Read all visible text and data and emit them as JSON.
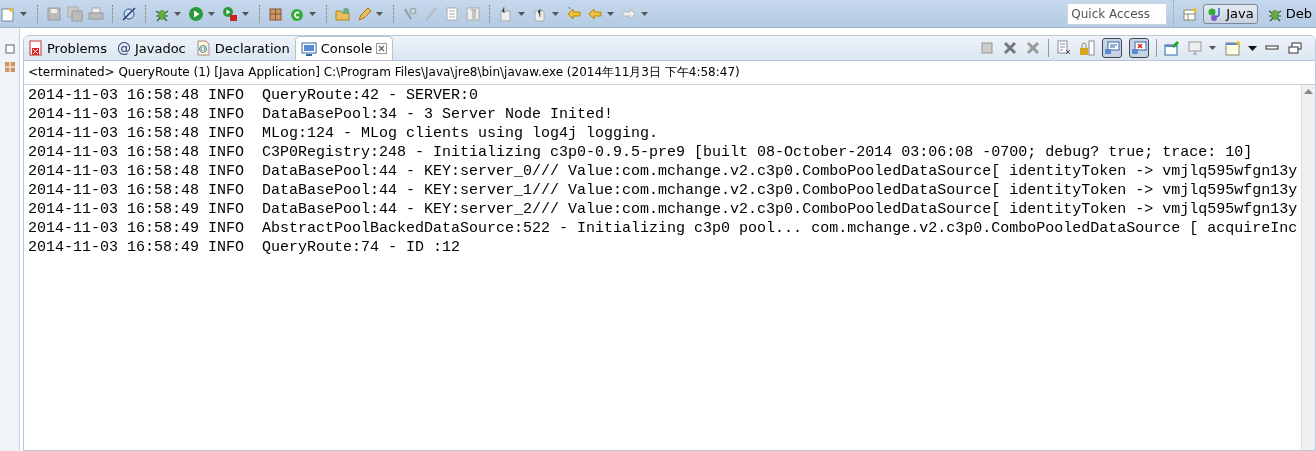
{
  "toolbar": {
    "quick_access": {
      "placeholder": "Quick Access"
    },
    "perspectives": [
      {
        "label": "Java",
        "selected": true
      },
      {
        "label": "Deb",
        "selected": false
      }
    ]
  },
  "view_tabs": [
    {
      "label": "Problems",
      "kind": "problems",
      "selected": false,
      "closable": false
    },
    {
      "label": "Javadoc",
      "kind": "javadoc",
      "icon_char": "@",
      "selected": false,
      "closable": false
    },
    {
      "label": "Declaration",
      "kind": "declaration",
      "selected": false,
      "closable": false
    },
    {
      "label": "Console",
      "kind": "console",
      "selected": true,
      "closable": true
    }
  ],
  "console": {
    "description": "<terminated> QueryRoute (1) [Java Application] C:\\Program Files\\Java\\jre8\\bin\\javaw.exe (2014年11月3日 下午4:58:47)",
    "lines": [
      "2014-11-03 16:58:48 INFO  QueryRoute:42 - SERVER:0",
      "2014-11-03 16:58:48 INFO  DataBasePool:34 - 3 Server Node Inited!",
      "2014-11-03 16:58:48 INFO  MLog:124 - MLog clients using log4j logging.",
      "2014-11-03 16:58:48 INFO  C3P0Registry:248 - Initializing c3p0-0.9.5-pre9 [built 08-October-2014 03:06:08 -0700; debug? true; trace: 10]",
      "2014-11-03 16:58:48 INFO  DataBasePool:44 - KEY:server_0/// Value:com.mchange.v2.c3p0.ComboPooledDataSource[ identityToken -> vmjlq595wfgn13y",
      "2014-11-03 16:58:48 INFO  DataBasePool:44 - KEY:server_1/// Value:com.mchange.v2.c3p0.ComboPooledDataSource[ identityToken -> vmjlq595wfgn13y",
      "2014-11-03 16:58:49 INFO  DataBasePool:44 - KEY:server_2/// Value:com.mchange.v2.c3p0.ComboPooledDataSource[ identityToken -> vmjlq595wfgn13y",
      "2014-11-03 16:58:49 INFO  AbstractPoolBackedDataSource:522 - Initializing c3p0 pool... com.mchange.v2.c3p0.ComboPooledDataSource [ acquireInc",
      "2014-11-03 16:58:49 INFO  QueryRoute:74 - ID :12"
    ]
  }
}
